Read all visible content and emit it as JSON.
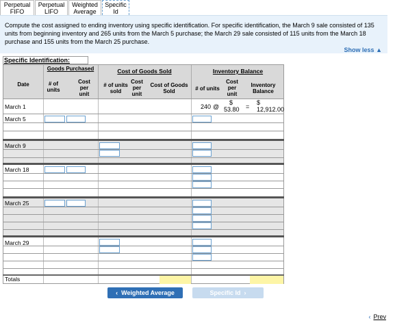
{
  "tabs": [
    {
      "line1": "Perpetual",
      "line2": "FIFO"
    },
    {
      "line1": "Perpetual",
      "line2": "LIFO"
    },
    {
      "line1": "Weighted",
      "line2": "Average"
    },
    {
      "line1": "Specific",
      "line2": "Id"
    }
  ],
  "instructions": "Compute the cost assigned to ending inventory using specific identification. For specific identification, the March 9 sale consisted of 135 units from beginning inventory and 265 units from the March 5 purchase; the March 29 sale consisted of 115 units from the March 18 purchase and 155 units from the March 25 purchase.",
  "show_less": "Show less",
  "table": {
    "title": "Specific Identification:",
    "groups": {
      "goods_purchased": "Goods Purchased",
      "cogs": "Cost of Goods Sold",
      "inventory": "Inventory Balance"
    },
    "columns": {
      "date": "Date",
      "units": "# of units",
      "cost_per_unit": "Cost per unit",
      "units_sold": "# of units sold",
      "cost_per_unit2": "Cost per unit",
      "cost_goods_sold": "Cost of Goods Sold",
      "inv_units": "# of units",
      "inv_cost_per_unit": "Cost per unit",
      "inventory_balance": "Inventory Balance"
    },
    "march1": {
      "date": "March 1",
      "units": "240",
      "at": "@",
      "dollar": "$",
      "cost": "53.80",
      "eq": "=",
      "dollar2": "$",
      "balance": "12,912.00"
    },
    "dates": {
      "march5": "March 5",
      "march9": "March 9",
      "march18": "March 18",
      "march25": "March 25",
      "march29": "March 29",
      "totals": "Totals"
    }
  },
  "buttons": {
    "prev": "Weighted Average",
    "next": "Specific Id",
    "page_prev": "Prev"
  }
}
